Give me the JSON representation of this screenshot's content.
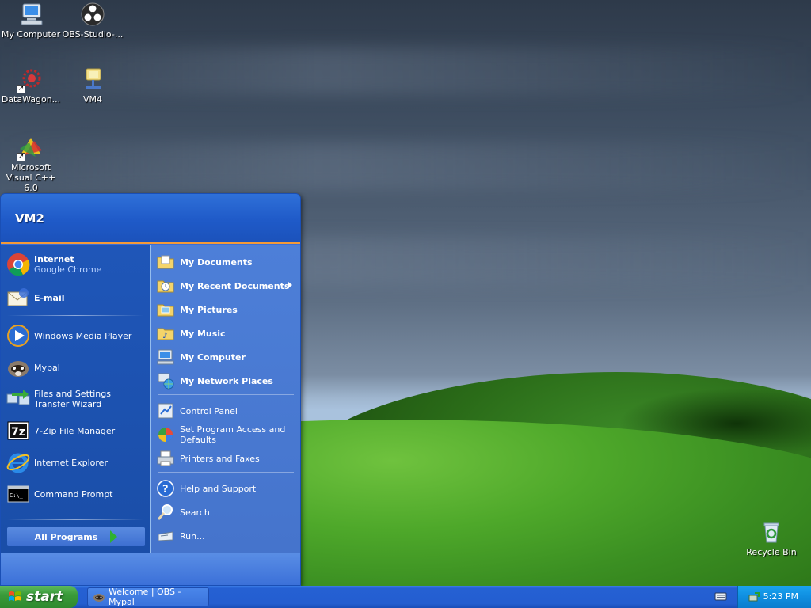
{
  "desktop": {
    "icons": [
      {
        "label": "My Computer"
      },
      {
        "label": "OBS-Studio-..."
      },
      {
        "label": "DataWagon..."
      },
      {
        "label": "VM4"
      },
      {
        "label": "Microsoft Visual C++ 6.0"
      },
      {
        "label": "Recycle Bin"
      }
    ]
  },
  "start_menu": {
    "user": "VM2",
    "pinned": [
      {
        "title": "Internet",
        "subtitle": "Google Chrome"
      },
      {
        "title": "E-mail"
      }
    ],
    "recent": [
      {
        "label": "Windows Media Player"
      },
      {
        "label": "Mypal"
      },
      {
        "label": "Files and Settings Transfer Wizard"
      },
      {
        "label": "7-Zip File Manager"
      },
      {
        "label": "Internet Explorer"
      },
      {
        "label": "Command Prompt"
      }
    ],
    "all_programs": "All Programs",
    "right": [
      {
        "label": "My Documents"
      },
      {
        "label": "My Recent Documents"
      },
      {
        "label": "My Pictures"
      },
      {
        "label": "My Music"
      },
      {
        "label": "My Computer"
      },
      {
        "label": "My Network Places"
      },
      {
        "label": "Control Panel"
      },
      {
        "label": "Set Program Access and Defaults"
      },
      {
        "label": "Printers and Faxes"
      },
      {
        "label": "Help and Support"
      },
      {
        "label": "Search"
      },
      {
        "label": "Run..."
      }
    ]
  },
  "taskbar": {
    "start_label": "start",
    "tasks": [
      {
        "label": "Welcome | OBS - Mypal"
      }
    ],
    "clock": "5:23 PM"
  }
}
